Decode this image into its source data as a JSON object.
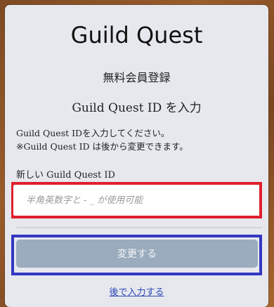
{
  "header": {
    "app_title": "Guild Quest",
    "section_title": "無料会員登録",
    "step_title": "Guild Quest ID を入力"
  },
  "main": {
    "description": "Guild Quest IDを入力してください。\n※Guild Quest ID は後から変更できます。",
    "field_label": "新しい Guild Quest ID",
    "input": {
      "value": "",
      "placeholder": "半角英数字と - _ が使用可能"
    },
    "submit_label": "変更する",
    "later_link_label": "後で入力する"
  },
  "colors": {
    "background": "#8a5428",
    "card": "#e6e8ee",
    "input_highlight": "#e01f2d",
    "button_highlight": "#3437c2",
    "button_fill": "#9aacbd",
    "link": "#2e48b7"
  }
}
